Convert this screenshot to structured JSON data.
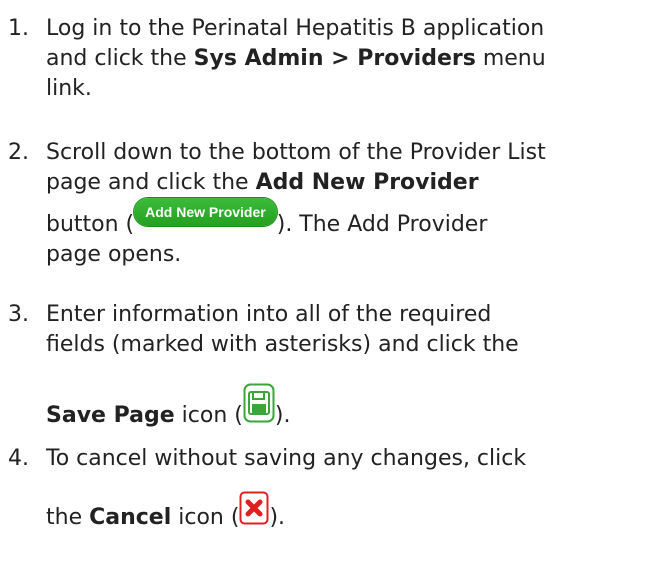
{
  "steps": [
    {
      "number": "1.",
      "line1": "Log in to the Perinatal Hepatitis B application",
      "line2_pre": "and click the ",
      "line2_bold": "Sys Admin > Providers",
      "line2_post": " menu",
      "line3": "link."
    },
    {
      "number": "2.",
      "line1": "Scroll down to the bottom of the Provider List",
      "line2_pre": "page and click the ",
      "line2_bold": "Add New Provider",
      "line3_pre": "button (",
      "button_label": "Add New Provider",
      "line3_post": "). The Add Provider",
      "line4": "page opens."
    },
    {
      "number": "3.",
      "line1": "Enter information into all of the required",
      "line2": "fields (marked with asterisks) and click the",
      "line3_bold": "Save Page",
      "line3_mid": " icon (",
      "line3_post": ")."
    },
    {
      "number": "4.",
      "line1": "To cancel without saving any changes, click",
      "line2_pre": "the ",
      "line2_bold": "Cancel",
      "line2_mid": " icon (",
      "line2_post": ")."
    }
  ],
  "icons": {
    "save": "save-floppy-icon",
    "cancel": "cancel-x-icon"
  },
  "colors": {
    "button_green": "#2eac2b",
    "save_green": "#3aa53a",
    "cancel_red": "#e02020",
    "text": "#222222"
  }
}
